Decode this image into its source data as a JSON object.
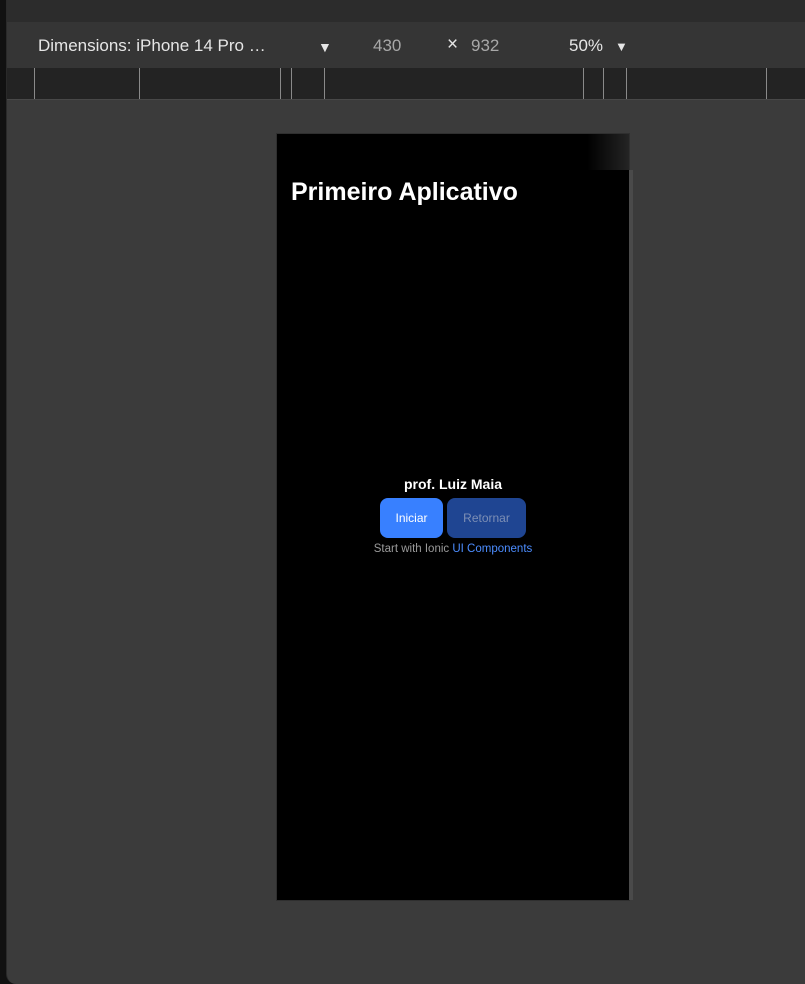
{
  "toolbar": {
    "dimensions_label": "Dimensions: iPhone 14 Pro …",
    "dropdown_arrow": "▼",
    "width": "430",
    "times": "×",
    "height": "932",
    "zoom": "50%",
    "zoom_arrow": "▼"
  },
  "app": {
    "title": "Primeiro Aplicativo",
    "author": "prof. Luiz Maia",
    "buttons": {
      "iniciar": "Iniciar",
      "retornar": "Retornar"
    },
    "start_text": "Start with Ionic",
    "start_link": "UI Components"
  },
  "colors": {
    "primary": "#3880ff",
    "primary_disabled": "#1f4592",
    "link": "#4c8dff"
  },
  "icons": [
    "chevron-down-icon",
    "close-icon"
  ]
}
